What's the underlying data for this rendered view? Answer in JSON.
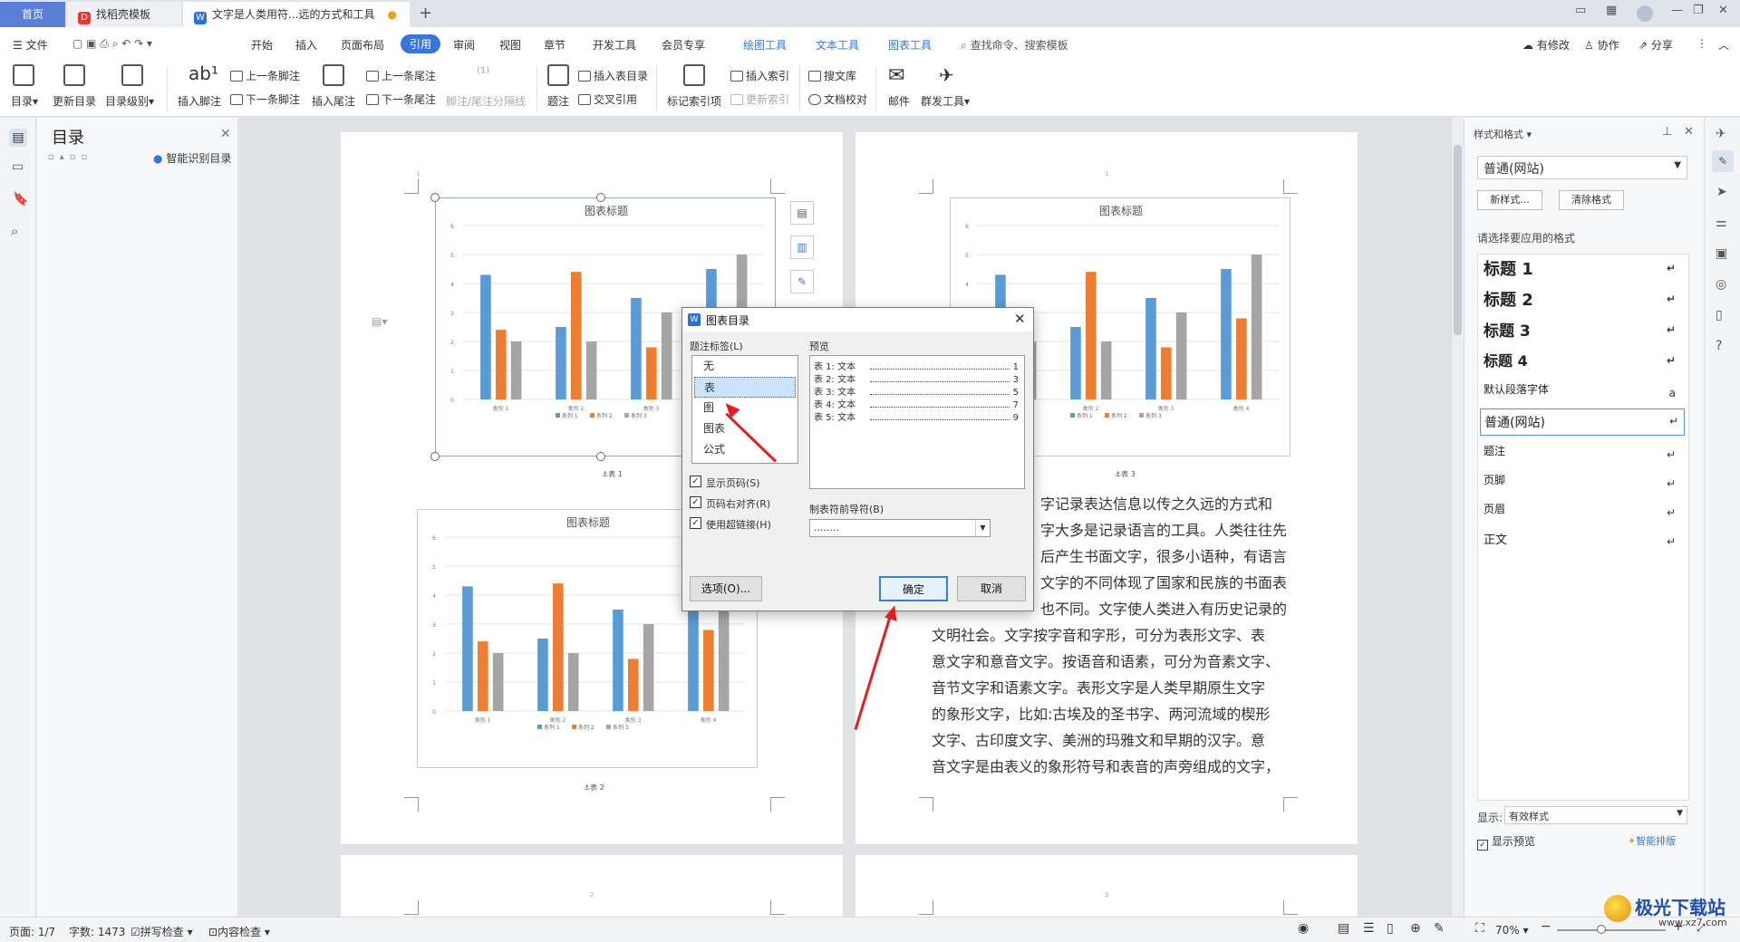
{
  "tabs": {
    "home": "首页",
    "template": "找稻壳模板",
    "doc": "文字是人类用符...远的方式和工具"
  },
  "menu": {
    "file": "文件",
    "items": [
      "开始",
      "插入",
      "页面布局",
      "引用",
      "审阅",
      "视图",
      "章节",
      "开发工具",
      "会员专享"
    ],
    "tools": [
      "绘图工具",
      "文本工具",
      "图表工具"
    ],
    "search": "查找命令、搜索模板",
    "modified": "有修改",
    "collab": "协作",
    "share": "分享"
  },
  "ribbon": {
    "toc": "目录",
    "update_toc": "更新目录",
    "toc_level": "目录级别",
    "insert_footnote": "插入脚注",
    "prev_footnote": "上一条脚注",
    "next_footnote": "下一条脚注",
    "insert_endnote": "插入尾注",
    "prev_endnote": "上一条尾注",
    "next_endnote": "下一条尾注",
    "separator": "脚注/尾注分隔线",
    "caption": "题注",
    "insert_table_toc": "插入表目录",
    "cross_ref": "交叉引用",
    "mark_index": "标记索引项",
    "insert_index": "插入索引",
    "update_index": "更新索引",
    "search_lib": "搜文库",
    "doc_check": "文档校对",
    "mail": "邮件",
    "mass_tool": "群发工具"
  },
  "toc_pane": {
    "title": "目录",
    "smart": "智能识别目录"
  },
  "chart": {
    "title": "图表标题",
    "yticks": [
      "6",
      "5",
      "4",
      "3",
      "2",
      "1",
      "0"
    ],
    "categories": [
      "类别 1",
      "类别 2",
      "类别 3",
      "类别 4"
    ],
    "legend": [
      "系列 1",
      "系列 2",
      "系列 3"
    ]
  },
  "chart_data": {
    "type": "bar",
    "title": "图表标题",
    "categories": [
      "类别 1",
      "类别 2",
      "类别 3",
      "类别 4"
    ],
    "series": [
      {
        "name": "系列 1",
        "values": [
          4.3,
          2.5,
          3.5,
          4.5
        ]
      },
      {
        "name": "系列 2",
        "values": [
          2.4,
          4.4,
          1.8,
          2.8
        ]
      },
      {
        "name": "系列 3",
        "values": [
          2,
          2,
          3,
          5
        ]
      }
    ],
    "ylim": [
      0,
      6
    ],
    "colors": [
      "#5b9bd5",
      "#ed7d31",
      "#a5a5a5"
    ]
  },
  "captions": {
    "c1": "表 1",
    "c2": "表 2",
    "c3": "表 3"
  },
  "page_numbers": {
    "p1": "1",
    "p1b": "1",
    "p2": "2",
    "p3": "3"
  },
  "body_lines": [
    "字记录表达信息以传之久远的方式和",
    "字大多是记录语言的工具。人类往往先",
    "后产生书面文字，很多小语种，有语言",
    "文字的不同体现了国家和民族的书面表",
    "也不同。文字使人类进入有历史记录的",
    "文明社会。文字按字音和字形，可分为表形文字、表",
    "意文字和意音文字。按语音和语素，可分为音素文字、",
    "音节文字和语素文字。表形文字是人类早期原生文字",
    "的象形文字，比如:古埃及的圣书字、两河流域的楔形",
    "文字、古印度文字、美洲的玛雅文和早期的汉字。意",
    "音文字是由表义的象形符号和表音的声旁组成的文字，"
  ],
  "dialog": {
    "title": "图表目录",
    "label_caption": "题注标签(L)",
    "list": [
      "无",
      "表",
      "图",
      "图表",
      "公式"
    ],
    "preview": "预览",
    "preview_lines": [
      "表 1: 文本",
      "表 2: 文本",
      "表 3: 文本",
      "表 4: 文本",
      "表 5: 文本"
    ],
    "preview_pages": [
      "1",
      "3",
      "5",
      "7",
      "9"
    ],
    "show_page": "显示页码(S)",
    "right_align": "页码右对齐(R)",
    "hyperlink": "使用超链接(H)",
    "leader_label": "制表符前导符(B)",
    "leader_value": "........",
    "options": "选项(O)...",
    "ok": "确定",
    "cancel": "取消"
  },
  "right_pane": {
    "title": "样式和格式",
    "current": "普通(网站)",
    "new_style": "新样式...",
    "clear": "清除格式",
    "prompt": "请选择要应用的格式",
    "styles": [
      "标题  1",
      "标题  2",
      "标题  3",
      "标题  4",
      "默认段落字体",
      "普通(网站)",
      "题注",
      "页脚",
      "页眉",
      "正文"
    ],
    "show_label": "显示:",
    "show_value": "有效样式",
    "show_preview": "显示预览",
    "smart_layout": "智能排版"
  },
  "status": {
    "page": "页面: 1/7",
    "words": "字数: 1473",
    "spell": "拼写检查",
    "content": "内容检查",
    "zoom": "70%"
  },
  "watermark": {
    "brand": "极光下载站",
    "url": "www.xz7.com"
  }
}
